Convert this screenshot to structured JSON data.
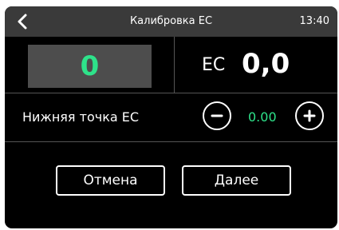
{
  "topbar": {
    "back_icon": "chevron-left-icon",
    "title": "Калибровка EC",
    "time": "13:40"
  },
  "measurement": {
    "raw_value": "0",
    "ec_label": "EC",
    "ec_value": "0,0"
  },
  "calibration_point": {
    "label": "Нижняя точка EC",
    "value": "0.00",
    "minus_icon": "minus-circle-icon",
    "plus_icon": "plus-circle-icon"
  },
  "actions": {
    "cancel_label": "Отмена",
    "next_label": "Далее"
  },
  "colors": {
    "accent_green": "#2ee28a",
    "topbar_bg": "#3a3a3a",
    "screen_bg": "#000000",
    "raw_box_bg": "#4d4d4d"
  }
}
